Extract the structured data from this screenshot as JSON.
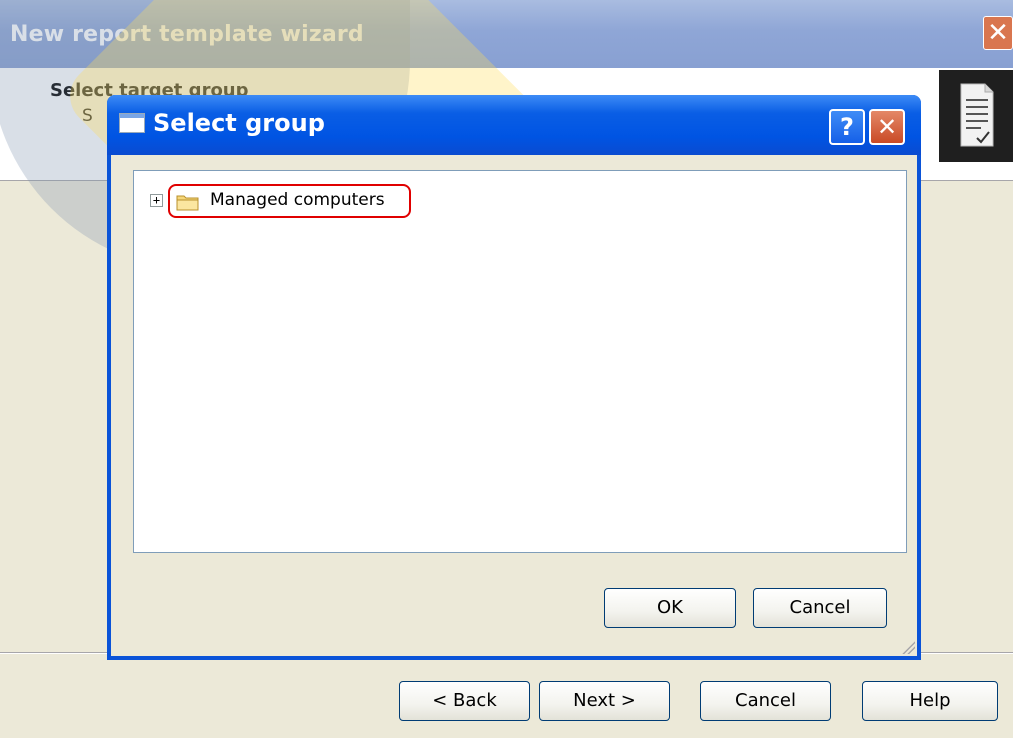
{
  "wizard": {
    "title": "New report template wizard",
    "close_glyph": "✕",
    "header": {
      "title": "Select target group",
      "subtitle": "S"
    },
    "buttons": {
      "back": "< Back",
      "next": "Next >",
      "cancel": "Cancel",
      "help": "Help"
    }
  },
  "dialog": {
    "title": "Select group",
    "help_glyph": "?",
    "close_glyph": "✕",
    "tree": {
      "expander": "+",
      "items": [
        {
          "label": "Managed computers",
          "icon": "folder-icon",
          "highlighted": true
        }
      ]
    },
    "buttons": {
      "ok": "OK",
      "cancel": "Cancel"
    }
  },
  "colors": {
    "dialog_titlebar": "#0054e3",
    "wizard_titlebar": "#8fa6d6",
    "highlight_box": "#e00000",
    "window_background": "#ece9d8"
  }
}
